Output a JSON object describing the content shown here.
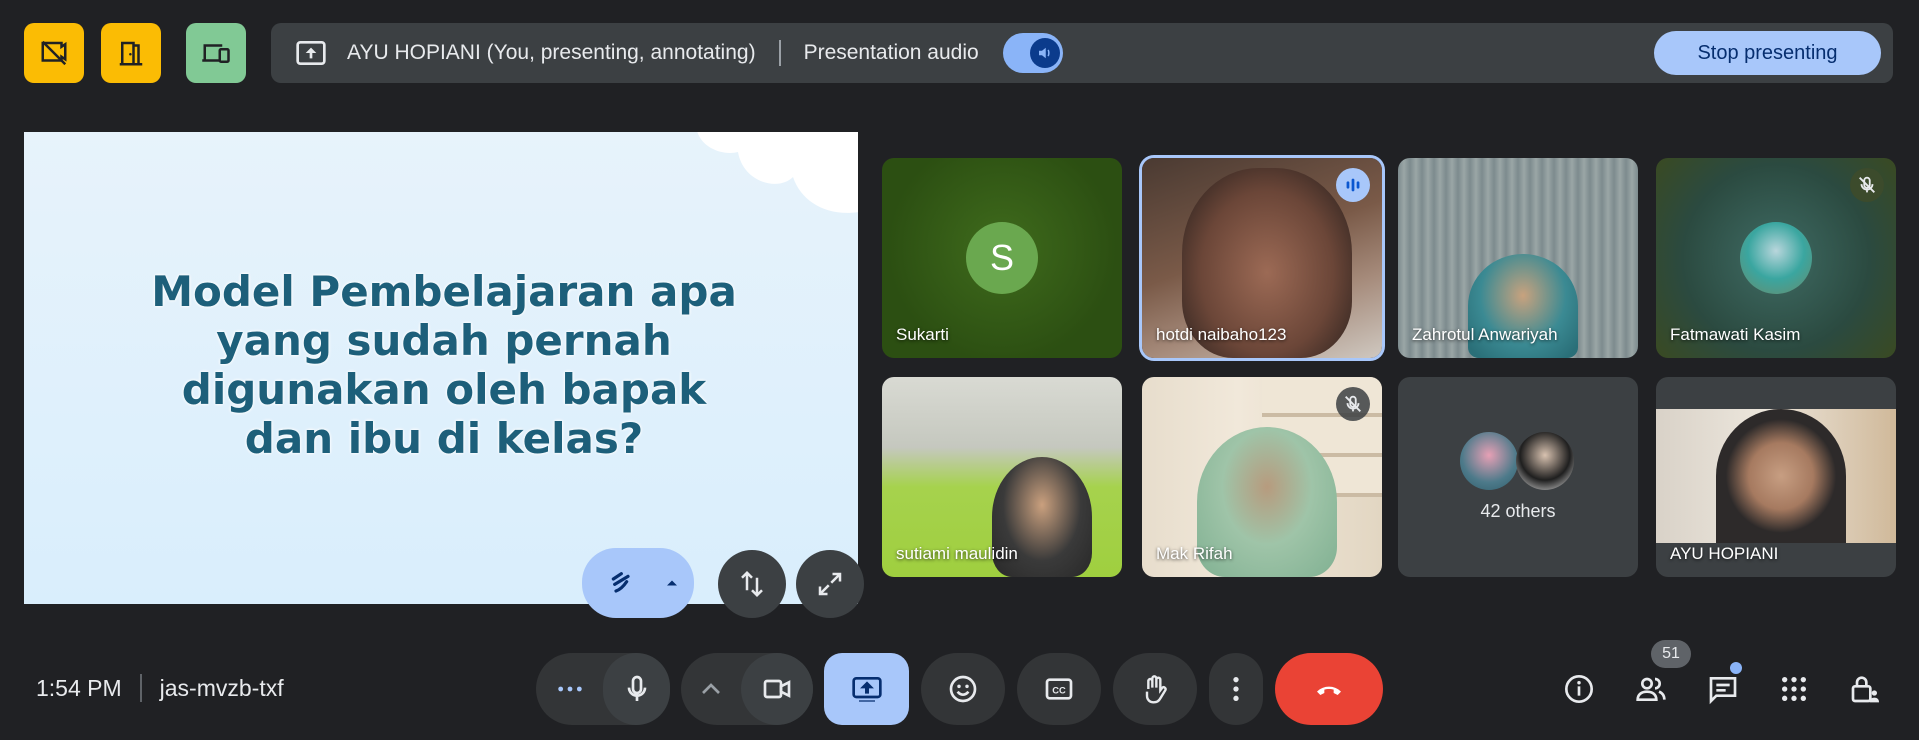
{
  "status_buttons": [
    {
      "icon": "no-video-hidden-icon",
      "color": "#fbbc04"
    },
    {
      "icon": "door-icon",
      "color": "#fbbc04"
    },
    {
      "icon": "devices-icon",
      "color": "#81c995"
    }
  ],
  "presenting_bar": {
    "presenter_label": "AYU HOPIANI (You, presenting, annotating)",
    "presentation_audio_label": "Presentation audio",
    "presentation_audio_on": true,
    "stop_button_label": "Stop presenting",
    "accent_color": "#a8c7fa"
  },
  "slide": {
    "text_lines": [
      "Model Pembelajaran apa",
      "yang sudah pernah",
      "digunakan oleh bapak",
      "dan ibu di kelas?"
    ],
    "controls": [
      "annotate-pen-icon",
      "expand-menu-icon",
      "swap-layout-icon",
      "fullscreen-icon"
    ]
  },
  "participants": [
    {
      "name": "Sukarti",
      "initial": "S",
      "type": "avatar"
    },
    {
      "name": "hotdi naibaho123",
      "type": "video",
      "speaking": true
    },
    {
      "name": "Zahrotul Anwariyah",
      "type": "video"
    },
    {
      "name": "Fatmawati Kasim",
      "type": "photo",
      "muted": true
    },
    {
      "name": "sutiami maulidin",
      "type": "video"
    },
    {
      "name": "Mak Rifah",
      "type": "video",
      "muted": true
    },
    {
      "name": "42 others",
      "type": "others"
    },
    {
      "name": "AYU HOPIANI",
      "type": "video"
    }
  ],
  "bottom_bar": {
    "time": "1:54 PM",
    "meeting_code": "jas-mvzb-txf",
    "participant_count": "51",
    "end_call_color": "#ea4335"
  }
}
